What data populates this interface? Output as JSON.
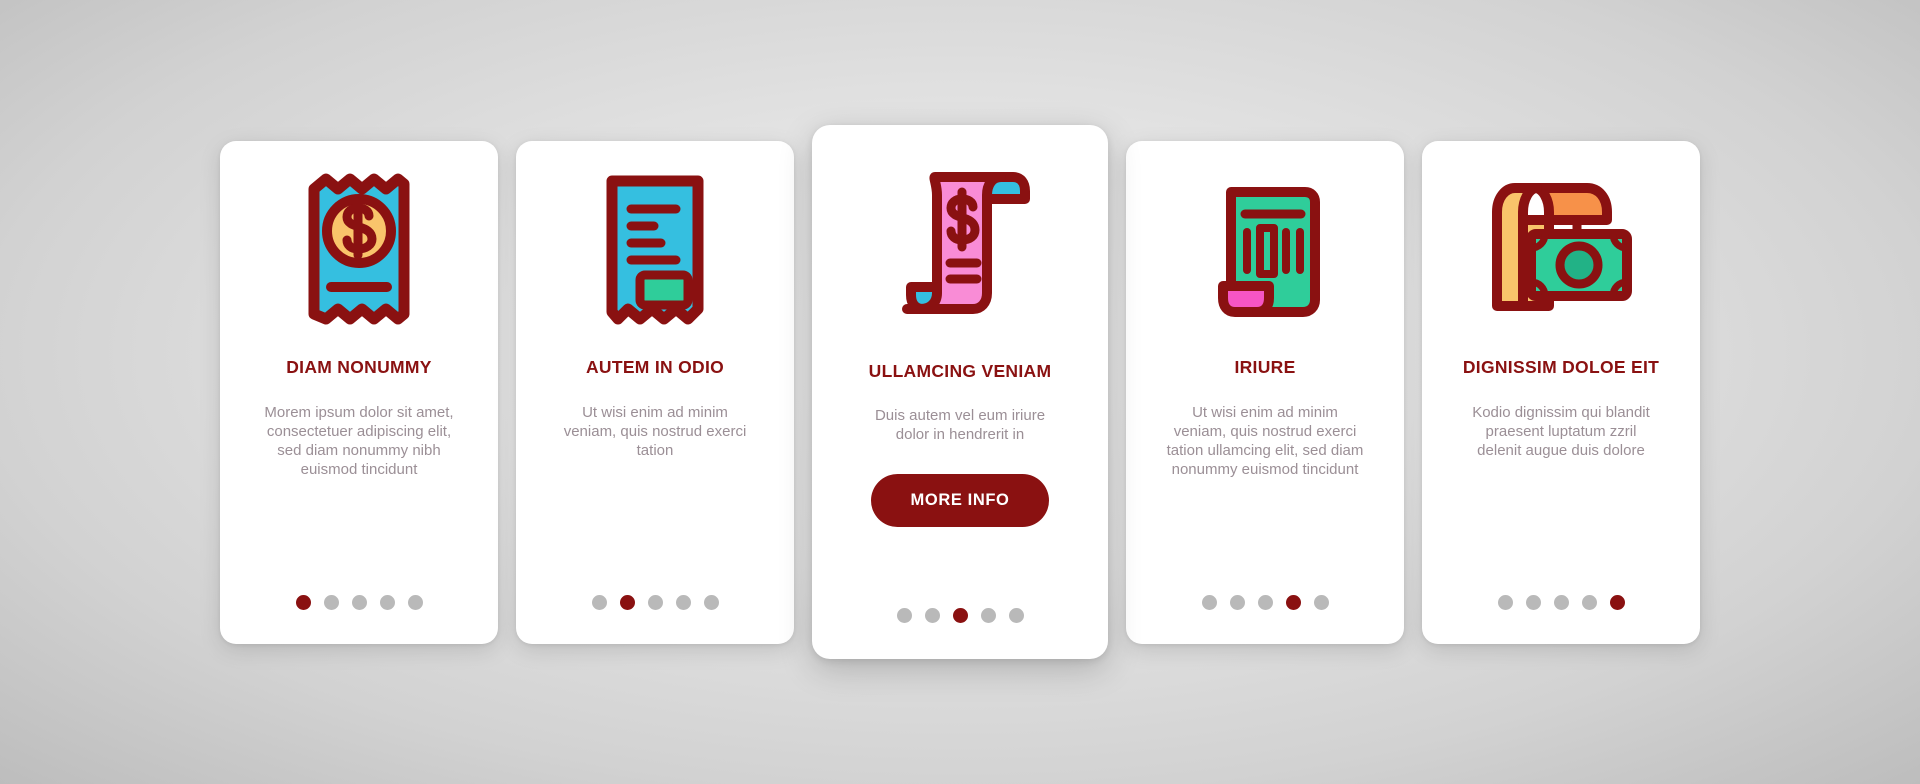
{
  "theme": {
    "background": "#e0e0e0",
    "card_background": "#ffffff",
    "accent": "#8a1111",
    "title_color": "#8a1111",
    "body_text_color": "#9b8f96",
    "dot_inactive": "#b9b9b9",
    "dot_active": "#8a1111",
    "icon_outline": "#8a1111",
    "icon_blue": "#35bfe0",
    "icon_yellow": "#f9c46b",
    "icon_green": "#2fcd9a",
    "icon_pink": "#f98cd6",
    "icon_magenta": "#f655c4",
    "icon_orange": "#f79149"
  },
  "cards": [
    {
      "icon_name": "receipt-dollar-icon",
      "title": "DIAM NONUMMY",
      "body": "Morem ipsum dolor sit amet, consectetuer adipiscing elit, sed diam nonummy nibh euismod tincidunt",
      "dots": 5,
      "active_dot": 1,
      "featured": false,
      "button_label": null
    },
    {
      "icon_name": "receipt-lines-icon",
      "title": "AUTEM IN ODIO",
      "body": "Ut wisi enim ad minim veniam, quis nostrud exerci tation",
      "dots": 5,
      "active_dot": 2,
      "featured": false,
      "button_label": null
    },
    {
      "icon_name": "scroll-dollar-icon",
      "title": "ULLAMCING VENIAM",
      "body": "Duis autem vel eum iriure dolor in hendrerit in",
      "dots": 5,
      "active_dot": 3,
      "featured": true,
      "button_label": "MORE INFO"
    },
    {
      "icon_name": "receipt-barcode-icon",
      "title": "IRIURE",
      "body": "Ut wisi enim ad minim veniam, quis nostrud exerci tation ullamcing elit, sed diam nonummy euismod tincidunt",
      "dots": 5,
      "active_dot": 4,
      "featured": false,
      "button_label": null
    },
    {
      "icon_name": "receipt-banknote-icon",
      "title": "DIGNISSIM DOLOE EIT",
      "body": "Kodio dignissim qui blandit praesent luptatum zzril delenit augue duis dolore",
      "dots": 5,
      "active_dot": 5,
      "featured": false,
      "button_label": null
    }
  ]
}
